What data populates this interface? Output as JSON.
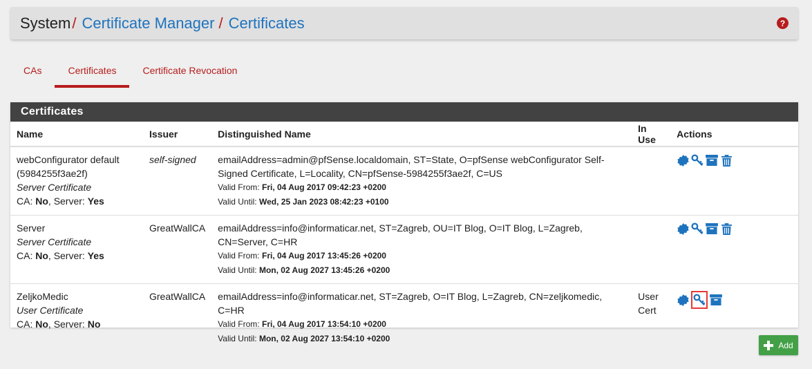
{
  "breadcrumb": {
    "root": "System",
    "sep": "/",
    "level1": "Certificate Manager",
    "level2": "Certificates"
  },
  "help": {
    "glyph": "?"
  },
  "tabs": [
    {
      "label": "CAs"
    },
    {
      "label": "Certificates"
    },
    {
      "label": "Certificate Revocation"
    }
  ],
  "panel": {
    "title": "Certificates"
  },
  "table": {
    "headers": {
      "name": "Name",
      "issuer": "Issuer",
      "dn": "Distinguished Name",
      "inuse": "In Use",
      "actions": "Actions"
    },
    "labels": {
      "ca": "CA:",
      "server": "Server:",
      "valid_from": "Valid From:",
      "valid_until": "Valid Until:"
    },
    "rows": [
      {
        "name": "webConfigurator default (5984255f3ae2f)",
        "type": "Server Certificate",
        "ca": "No",
        "server": "Yes",
        "issuer": "self-signed",
        "dn": "emailAddress=admin@pfSense.localdomain, ST=State, O=pfSense webConfigurator Self-Signed Certificate, L=Locality, CN=pfSense-5984255f3ae2f, C=US",
        "valid_from": "Fri, 04 Aug 2017 09:42:23 +0200",
        "valid_until": "Wed, 25 Jan 2023 08:42:23 +0100",
        "inuse": ""
      },
      {
        "name": "Server",
        "type": "Server Certificate",
        "ca": "No",
        "server": "Yes",
        "issuer": "GreatWallCA",
        "dn": "emailAddress=info@informaticar.net, ST=Zagreb, OU=IT Blog, O=IT Blog, L=Zagreb, CN=Server, C=HR",
        "valid_from": "Fri, 04 Aug 2017 13:45:26 +0200",
        "valid_until": "Mon, 02 Aug 2027 13:45:26 +0200",
        "inuse": ""
      },
      {
        "name": "ZeljkoMedic",
        "type": "User Certificate",
        "ca": "No",
        "server": "No",
        "issuer": "GreatWallCA",
        "dn": "emailAddress=info@informaticar.net, ST=Zagreb, O=IT Blog, L=Zagreb, CN=zeljkomedic, C=HR",
        "valid_from": "Fri, 04 Aug 2017 13:54:10 +0200",
        "valid_until": "Mon, 02 Aug 2027 13:54:10 +0200",
        "inuse": "User Cert"
      }
    ]
  },
  "add_button": {
    "label": "Add"
  },
  "icons": {
    "export-cert": "certificate-icon",
    "export-key": "key-icon",
    "export-p12": "archive-icon",
    "delete": "trash-icon"
  },
  "colors": {
    "accent": "#b71c1c",
    "link": "#1e73be",
    "icon": "#1e73be",
    "panel_head": "#424242",
    "add": "#43a047",
    "highlight": "#e53935"
  }
}
